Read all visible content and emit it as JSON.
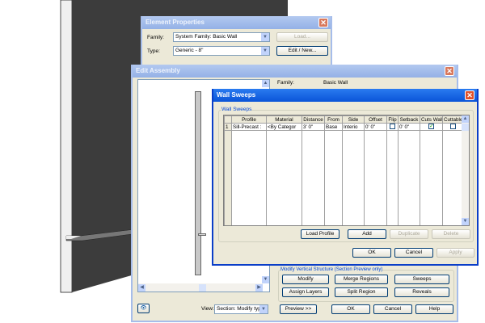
{
  "element_properties": {
    "title": "Element Properties",
    "family_label": "Family:",
    "family_value": "System Family: Basic Wall",
    "type_label": "Type:",
    "type_value": "Generic - 8\"",
    "load_button": "Load...",
    "edit_new_button": "Edit / New..."
  },
  "edit_assembly": {
    "title": "Edit Assembly",
    "family_label": "Family:",
    "family_value": "Basic Wall",
    "modify_group_label": "Modify Vertical Structure (Section Preview only)",
    "buttons": {
      "modify": "Modify",
      "merge_regions": "Merge Regions",
      "sweeps": "Sweeps",
      "assign_layers": "Assign Layers",
      "split_region": "Split Region",
      "reveals": "Reveals",
      "preview": "Preview >>",
      "ok": "OK",
      "cancel": "Cancel",
      "help": "Help"
    },
    "view_label": "View:",
    "view_value": "Section: Modify type -"
  },
  "wall_sweeps": {
    "title": "Wall Sweeps",
    "group_label": "Wall Sweeps",
    "columns": [
      "Profile",
      "Material",
      "Distance",
      "From",
      "Side",
      "Offset",
      "Flip",
      "Setback",
      "Cuts Wall",
      "Cuttable"
    ],
    "rows": [
      {
        "num": "1",
        "profile": "Sill-Precast :",
        "material": "<By Categor",
        "distance": "3'  0\"",
        "from": "Base",
        "side": "Interio",
        "offset": "0'  0\"",
        "flip": false,
        "setback": "0'  0\"",
        "cuts_wall": true,
        "cuttable": false
      }
    ],
    "buttons": {
      "load_profile": "Load Profile",
      "add": "Add",
      "duplicate": "Duplicate",
      "delete": "Delete",
      "ok": "OK",
      "cancel": "Cancel",
      "apply": "Apply"
    }
  }
}
